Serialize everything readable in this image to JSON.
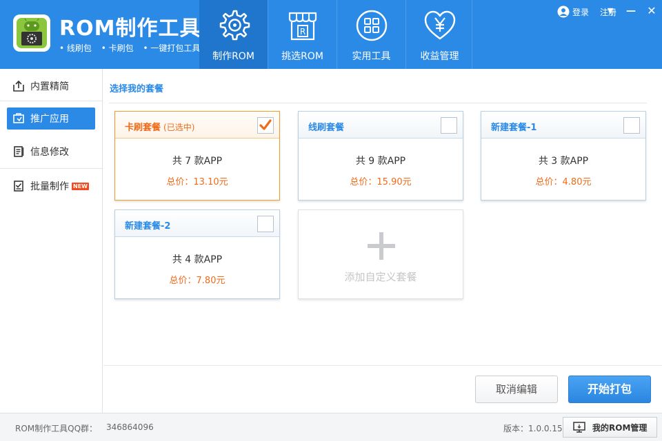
{
  "app": {
    "title": "ROM制作工具",
    "features": [
      "• 线刷包",
      "• 卡刷包",
      "• 一键打包工具"
    ]
  },
  "nav": [
    {
      "label": "制作ROM",
      "icon": "gear-disc-icon",
      "active": true
    },
    {
      "label": "挑选ROM",
      "icon": "rom-store-icon",
      "active": false
    },
    {
      "label": "实用工具",
      "icon": "grid-tools-icon",
      "active": false
    },
    {
      "label": "收益管理",
      "icon": "heart-yen-icon",
      "active": false
    }
  ],
  "account": {
    "login": "登录",
    "register": "注册",
    "menu_glyph": "▼",
    "minimize_glyph": "—",
    "close_glyph": "✕"
  },
  "sidebar": {
    "items": [
      {
        "label": "内置精简",
        "icon": "export-box-icon",
        "active": false
      },
      {
        "label": "推广应用",
        "icon": "promote-icon",
        "active": true
      },
      {
        "label": "信息修改",
        "icon": "document-edit-icon",
        "active": false
      },
      {
        "label": "批量制作",
        "icon": "checklist-icon",
        "active": false,
        "badge": "NEW"
      }
    ]
  },
  "main": {
    "section_title": "选择我的套餐",
    "packages": [
      {
        "name": "卡刷套餐",
        "sub": "(已选中)",
        "count": "共 7 款APP",
        "price": "总价：13.10元",
        "selected": true
      },
      {
        "name": "线刷套餐",
        "sub": "",
        "count": "共 9 款APP",
        "price": "总价：15.90元",
        "selected": false
      },
      {
        "name": "新建套餐-1",
        "sub": "",
        "count": "共 3 款APP",
        "price": "总价：4.80元",
        "selected": false
      },
      {
        "name": "新建套餐-2",
        "sub": "",
        "count": "共 4 款APP",
        "price": "总价：7.80元",
        "selected": false
      }
    ],
    "add_label": "添加自定义套餐"
  },
  "actions": {
    "cancel": "取消编辑",
    "start": "开始打包"
  },
  "footer": {
    "qq_label": "ROM制作工具QQ群：",
    "qq_number": "346864096",
    "version": "版本：1.0.0.15",
    "rom_manage": "我的ROM管理"
  },
  "colors": {
    "primary": "#2a8ae6",
    "nav_active": "#1f76cc",
    "accent": "#ef6b1a",
    "badge": "#f04a1e"
  }
}
